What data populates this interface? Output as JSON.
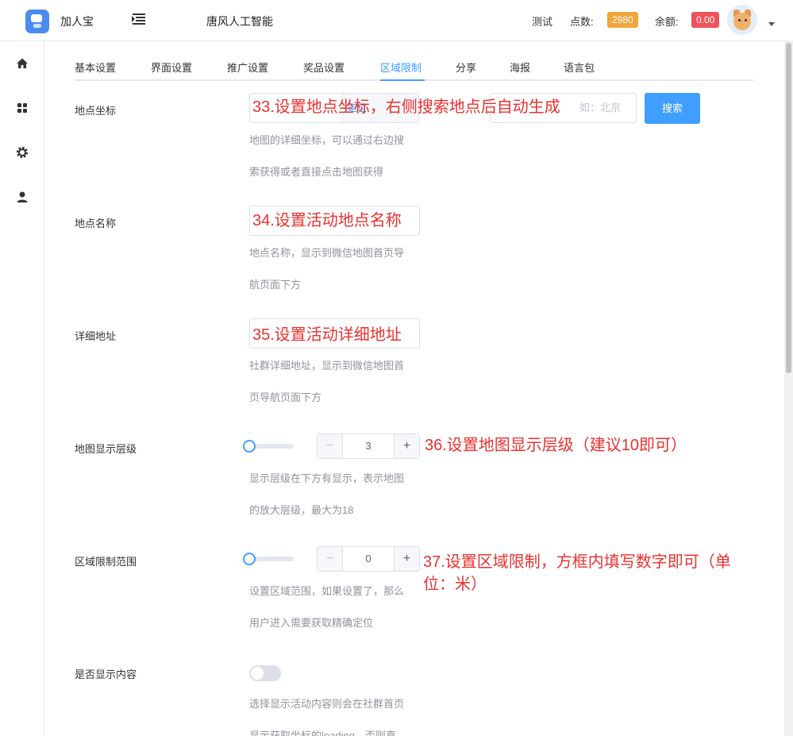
{
  "header": {
    "app_name": "加人宝",
    "company": "唐风人工智能",
    "user_name": "测试",
    "points_label": "点数:",
    "points_value": "2980",
    "balance_label": "余额:",
    "balance_value": "0.00"
  },
  "sidebar": {
    "items": [
      {
        "icon": "home-icon"
      },
      {
        "icon": "grid-icon"
      },
      {
        "icon": "gear-icon"
      },
      {
        "icon": "user-icon"
      }
    ]
  },
  "tabs": [
    {
      "label": "基本设置"
    },
    {
      "label": "界面设置"
    },
    {
      "label": "推广设置"
    },
    {
      "label": "奖品设置"
    },
    {
      "label": "区域限制",
      "active": true
    },
    {
      "label": "分享"
    },
    {
      "label": "海报"
    },
    {
      "label": "语言包"
    }
  ],
  "form": {
    "coordinate": {
      "label": "地点坐标",
      "suffix_text": "定位",
      "search_placeholder": "如：北京",
      "search_button": "搜索",
      "helper_1": "地图的详细坐标，可以通过右边搜",
      "helper_2": "索获得或者直接点击地图获得",
      "annotation": "33.设置地点坐标，右侧搜索地点后自动生成"
    },
    "place_name": {
      "label": "地点名称",
      "helper_1": "地点名称，显示到微信地图首页导",
      "helper_2": "航页面下方",
      "annotation": "34.设置活动地点名称"
    },
    "address": {
      "label": "详细地址",
      "helper_1": "社群详细地址，显示到微信地图首",
      "helper_2": "页导航页面下方",
      "annotation": "35.设置活动详细地址"
    },
    "map_zoom": {
      "label": "地图显示层级",
      "value": "3",
      "minus": "−",
      "plus": "+",
      "helper_1": "显示层级在下方有显示，表示地图",
      "helper_2": "的放大层级，最大为18",
      "annotation": "36.设置地图显示层级（建议10即可）"
    },
    "area_limit": {
      "label": "区域限制范围",
      "value": "0",
      "minus": "−",
      "plus": "+",
      "helper_1": "设置区域范围，如果设置了，那么",
      "helper_2": "用户进入需要获取精确定位",
      "annotation_1": "37.设置区域限制，方框内填写数字即可（单",
      "annotation_2": "位：米）"
    },
    "show_content": {
      "label": "是否显示内容",
      "helper_1": "选择显示活动内容则会在社群首页",
      "helper_2": "显示获取坐标的loading，否则直"
    }
  },
  "colors": {
    "primary": "#409eff",
    "annotation": "#e8312f",
    "points_badge": "#f0a63a",
    "balance_badge": "#f0515a"
  }
}
